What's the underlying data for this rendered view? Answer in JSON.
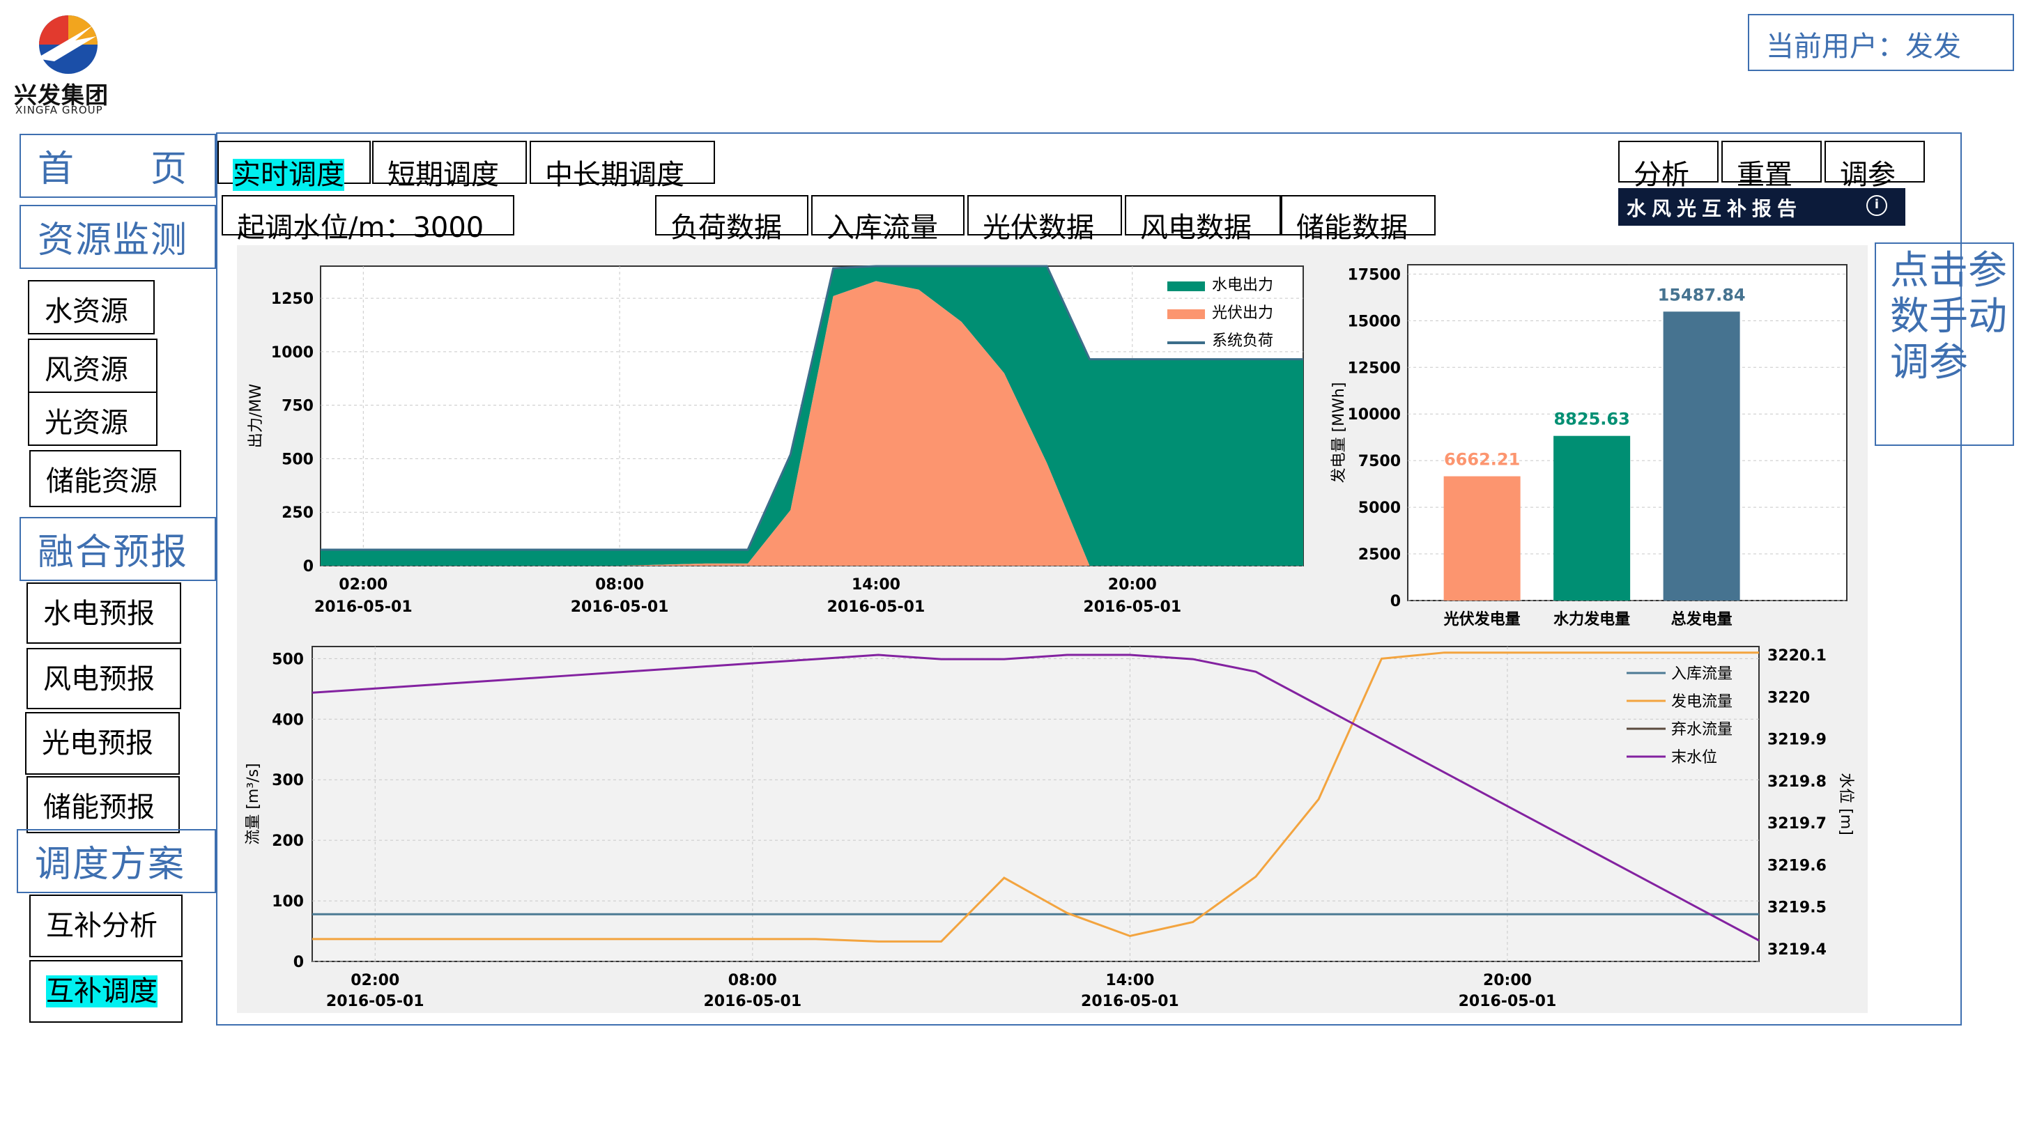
{
  "header": {
    "logo_text": "兴发集团",
    "logo_text_en": "XINGFA GROUP",
    "current_user": "当前用户：发发"
  },
  "sidebar": {
    "home": "首　　页",
    "groups": [
      {
        "label": "资源监测",
        "items": [
          "水资源",
          "风资源",
          "光资源",
          "储能资源"
        ]
      },
      {
        "label": "融合预报",
        "items": [
          "水电预报",
          "风电预报",
          "光电预报",
          "储能预报"
        ]
      },
      {
        "label": "调度方案",
        "items": [
          "互补分析",
          "互补调度"
        ]
      }
    ],
    "selected_item": "互补调度"
  },
  "tabs": [
    "实时调度",
    "短期调度",
    "中长期调度"
  ],
  "selected_tab": "实时调度",
  "start_level": "起调水位/m：3000",
  "data_buttons": [
    "负荷数据",
    "入库流量",
    "光伏数据",
    "风电数据",
    "储能数据"
  ],
  "action_buttons": [
    "分析",
    "重置",
    "调参"
  ],
  "report_banner": "水风光互补报告",
  "report_info_icon": "info-icon",
  "side_note": "点击参数手动调参",
  "colors": {
    "hydro": "#008f73",
    "pv": "#fc956f",
    "load": "#3b6e8a",
    "total": "#467390",
    "inflow": "#4c7a94",
    "gen_flow": "#f3a43f",
    "spill": "#5b4a3e",
    "level": "#8322a0",
    "accent": "#3e6fb0",
    "highlight": "#00f0f0"
  },
  "chart_data": [
    {
      "type": "area",
      "ylabel": "出力/MW",
      "ylim": [
        0,
        1400
      ],
      "yticks": [
        0,
        250,
        500,
        750,
        1000,
        1250
      ],
      "xticks": [
        {
          "x": 2,
          "time": "02:00",
          "date": "2016-05-01"
        },
        {
          "x": 8,
          "time": "08:00",
          "date": "2016-05-01"
        },
        {
          "x": 14,
          "time": "14:00",
          "date": "2016-05-01"
        },
        {
          "x": 20,
          "time": "20:00",
          "date": "2016-05-01"
        }
      ],
      "xlim": [
        1,
        24
      ],
      "legend_position": "top-right",
      "x": [
        1,
        2,
        3,
        4,
        5,
        6,
        7,
        8,
        9,
        10,
        11,
        12,
        13,
        14,
        15,
        16,
        17,
        18,
        19,
        20,
        21,
        22,
        23,
        24
      ],
      "series": [
        {
          "name": "光伏出力",
          "values": [
            0,
            0,
            0,
            0,
            0,
            0,
            0,
            0,
            5,
            10,
            10,
            260,
            1260,
            1330,
            1290,
            1140,
            900,
            480,
            0,
            0,
            0,
            0,
            0,
            0
          ]
        },
        {
          "name": "水电出力",
          "values": [
            75,
            75,
            75,
            75,
            75,
            75,
            75,
            75,
            70,
            65,
            65,
            260,
            130,
            70,
            110,
            260,
            500,
            920,
            965,
            965,
            965,
            965,
            965,
            965
          ]
        },
        {
          "name": "系统负荷",
          "values": [
            75,
            75,
            75,
            75,
            75,
            75,
            75,
            75,
            75,
            75,
            75,
            520,
            1390,
            1400,
            1400,
            1400,
            1400,
            1400,
            965,
            965,
            965,
            965,
            965,
            965
          ]
        }
      ]
    },
    {
      "type": "bar",
      "ylabel": "发电量 [MWh]",
      "ylim": [
        0,
        18000
      ],
      "yticks": [
        0,
        2500,
        5000,
        7500,
        10000,
        12500,
        15000,
        17500
      ],
      "categories": [
        "光伏发电量",
        "水力发电量",
        "总发电量"
      ],
      "values": [
        6662.21,
        8825.63,
        15487.84
      ],
      "value_labels": [
        "6662.21",
        "8825.63",
        "15487.84"
      ]
    },
    {
      "type": "line",
      "ylabel": "流量 [m³/s]",
      "y2label": "水位 [m]",
      "ylim": [
        0,
        520
      ],
      "yticks": [
        0,
        100,
        200,
        300,
        400,
        500
      ],
      "y2lim": [
        3219.37,
        3220.12
      ],
      "y2ticks": [
        "3219.4",
        "3219.5",
        "3219.6",
        "3219.7",
        "3219.8",
        "3219.9",
        "3220",
        "3220.1"
      ],
      "xlim": [
        1,
        24
      ],
      "xticks": [
        {
          "x": 2,
          "time": "02:00",
          "date": "2016-05-01"
        },
        {
          "x": 8,
          "time": "08:00",
          "date": "2016-05-01"
        },
        {
          "x": 14,
          "time": "14:00",
          "date": "2016-05-01"
        },
        {
          "x": 20,
          "time": "20:00",
          "date": "2016-05-01"
        }
      ],
      "legend_position": "top-right",
      "x": [
        1,
        2,
        3,
        4,
        5,
        6,
        7,
        8,
        9,
        10,
        11,
        12,
        13,
        14,
        15,
        16,
        17,
        18,
        19,
        20,
        21,
        22,
        23,
        24
      ],
      "series": [
        {
          "name": "入库流量",
          "axis": "left",
          "values": [
            78,
            78,
            78,
            78,
            78,
            78,
            78,
            78,
            78,
            78,
            78,
            78,
            78,
            78,
            78,
            78,
            78,
            78,
            78,
            78,
            78,
            78,
            78,
            78
          ]
        },
        {
          "name": "发电流量",
          "axis": "left",
          "values": [
            37,
            37,
            37,
            37,
            37,
            37,
            37,
            37,
            37,
            33,
            33,
            138,
            80,
            42,
            65,
            140,
            268,
            500,
            510,
            510,
            510,
            510,
            510,
            510
          ]
        },
        {
          "name": "弃水流量",
          "axis": "left",
          "values": []
        },
        {
          "name": "末水位",
          "axis": "right",
          "values": [
            3220.01,
            3220.02,
            3220.03,
            3220.04,
            3220.05,
            3220.06,
            3220.07,
            3220.08,
            3220.09,
            3220.1,
            3220.09,
            3220.09,
            3220.1,
            3220.1,
            3220.09,
            3220.06,
            3219.98,
            3219.9,
            3219.82,
            3219.74,
            3219.66,
            3219.58,
            3219.5,
            3219.42
          ]
        }
      ]
    }
  ]
}
